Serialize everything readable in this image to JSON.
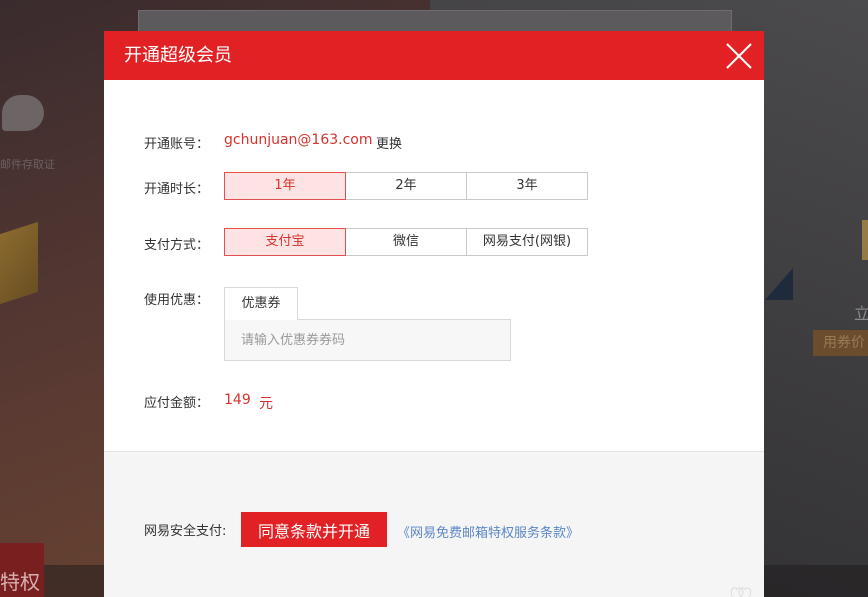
{
  "background": {
    "bubble_text": "邮件存取证",
    "right_char": "立",
    "right_tag": "用券价",
    "left_bottom_text": "特权"
  },
  "modal": {
    "title": "开通超级会员",
    "account": {
      "label": "开通账号：",
      "email": "gchunjuan@163.com",
      "change_label": "更换"
    },
    "duration": {
      "label": "开通时长：",
      "options": [
        "1年",
        "2年",
        "3年"
      ],
      "selected": "1年"
    },
    "payment": {
      "label": "支付方式：",
      "options": [
        "支付宝",
        "微信",
        "网易支付(网银)"
      ],
      "selected": "支付宝"
    },
    "coupon": {
      "label": "使用优惠：",
      "tab": "优惠券",
      "placeholder": "请输入优惠券券码"
    },
    "price": {
      "label": "应付金额：",
      "value": "149",
      "unit": "元"
    },
    "footer": {
      "secure_label": "网易安全支付:",
      "agree_button": "同意条款并开通",
      "terms_link": "《网易免费邮箱特权服务条款》"
    }
  },
  "colors": {
    "brand_red": "#e22124",
    "accent_red_text": "#d7322d",
    "link_blue": "#5b87c7",
    "selected_bg": "#fde3e3"
  },
  "icons": {
    "close": "close-icon"
  }
}
